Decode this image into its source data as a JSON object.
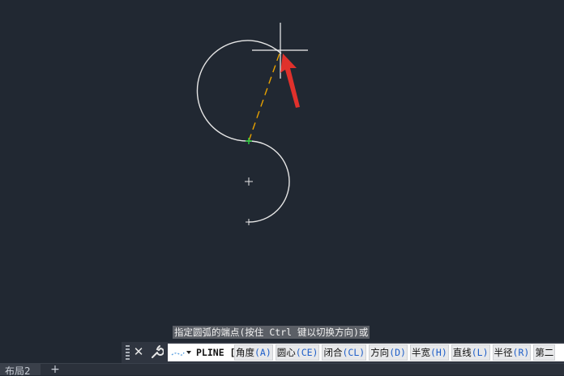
{
  "canvas": {
    "background": "#212832",
    "arc_color": "#e6e6e6",
    "rubber_band_color": "#e8a200",
    "annotation_arrow_color": "#e0312c"
  },
  "prompt": {
    "text": "指定圆弧的端点(按住 Ctrl 键以切换方向)或"
  },
  "command_line": {
    "close_icon": "close-icon",
    "customize_icon": "wrench-icon",
    "command": "PLINE [",
    "options": [
      {
        "label": "角度",
        "key": "(A)"
      },
      {
        "label": "圆心",
        "key": "(CE)"
      },
      {
        "label": "闭合",
        "key": "(CL)"
      },
      {
        "label": "方向",
        "key": "(D)"
      },
      {
        "label": "半宽",
        "key": "(H)"
      },
      {
        "label": "直线",
        "key": "(L)"
      },
      {
        "label": "半径",
        "key": "(R)"
      },
      {
        "label": "第二",
        "key": ""
      }
    ]
  },
  "status_bar": {
    "layout_tab": "布局2",
    "add_tab": "+"
  }
}
